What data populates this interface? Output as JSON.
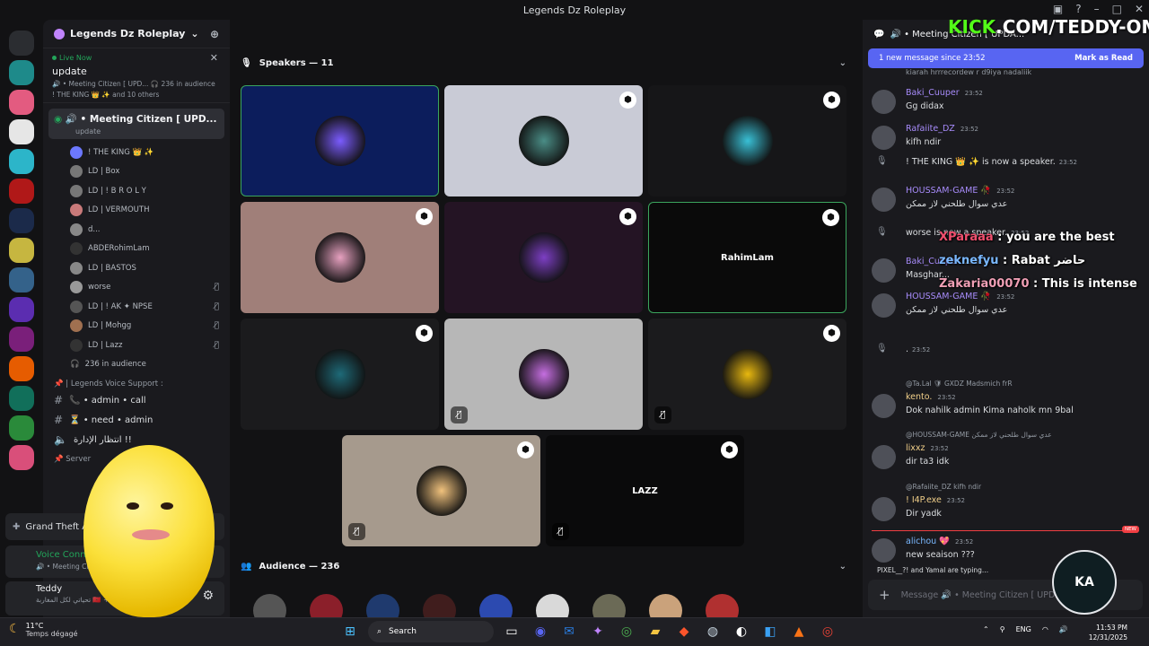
{
  "window": {
    "title": "Legends Dz Roleplay"
  },
  "server": {
    "name": "Legends Dz Roleplay",
    "live": {
      "badge": "Live Now",
      "title": "update",
      "details": "🔊 • Meeting Citizen [ UPD... 🎧 236 in audience",
      "people": "! THE KING 👑 ✨ and 10 others"
    },
    "voice_channel": {
      "name": "🔊 • Meeting Citizen [ UPD...",
      "status": "update"
    },
    "members": [
      {
        "name": "! THE KING 👑 ✨",
        "muted": false,
        "color": "#6c78ff"
      },
      {
        "name": "LD | Box",
        "muted": false,
        "color": "#777"
      },
      {
        "name": "LD | ! B R O L Y",
        "muted": false,
        "color": "#777"
      },
      {
        "name": "LD | VERMOUTH",
        "muted": false,
        "color": "#c97a7a"
      },
      {
        "name": "d...",
        "muted": false,
        "color": "#888"
      },
      {
        "name": "ABDERohimLam",
        "muted": false,
        "color": "#333"
      },
      {
        "name": "LD | BASTOS",
        "muted": false,
        "color": "#888"
      },
      {
        "name": "worse",
        "muted": true,
        "color": "#999"
      },
      {
        "name": "LD | ! AK ✦ NPSE",
        "muted": true,
        "color": "#555"
      },
      {
        "name": "LD | Mohgg",
        "muted": true,
        "color": "#a07050"
      },
      {
        "name": "LD | Lazz",
        "muted": true,
        "color": "#333"
      }
    ],
    "audience_count": "236 in audience",
    "category": "📌 | Legends Voice Support :",
    "text_channels": [
      {
        "name": "📞 • admin • call"
      },
      {
        "name": "⏳ • need • admin"
      },
      {
        "name": "انتظار الإدارة !!"
      }
    ],
    "category2": "📌 Server",
    "game": "Grand Theft Auto V",
    "voice_connected": {
      "status": "Voice Connected",
      "channel": "🔊 • Meeting Citi..."
    },
    "user": {
      "name": "Teddy",
      "status": "تحياتي لكل المغاربة 🇲🇦 +1"
    }
  },
  "stage": {
    "speakers_header": "Speakers — 11",
    "audience_header": "Audience — 236",
    "tiles": [
      {
        "bg": "#0c1d5c",
        "ring": "#7b5cff",
        "label": "",
        "pin": false,
        "muted": false
      },
      {
        "bg": "#c9cbd6",
        "ring": "#4a8d86",
        "label": "",
        "pin": true,
        "muted": false
      },
      {
        "bg": "#161618",
        "ring": "#39c0d6",
        "label": "",
        "pin": true,
        "muted": false
      },
      {
        "bg": "#a07f79",
        "ring": "#e7a1c0",
        "label": "",
        "pin": true,
        "muted": false
      },
      {
        "bg": "#241424",
        "ring": "#7d3fc4",
        "label": "",
        "pin": true,
        "muted": false
      },
      {
        "bg": "#0a0a0a",
        "ring": "#222",
        "label": "RahimLam",
        "pin": true,
        "muted": false
      },
      {
        "bg": "#1b1b1d",
        "ring": "#1e6a78",
        "label": "",
        "pin": true,
        "muted": false
      },
      {
        "bg": "#b7b7b7",
        "ring": "#c56ee0",
        "label": "",
        "pin": false,
        "muted": true
      },
      {
        "bg": "#1b1b1d",
        "ring": "#e8b80f",
        "label": "",
        "pin": true,
        "muted": true
      },
      {
        "bg": "#a69a8d",
        "ring": "#f1c27d",
        "label": "",
        "pin": true,
        "muted": true
      },
      {
        "bg": "#0a0a0b",
        "ring": "#222",
        "label": "LAZZ",
        "pin": true,
        "muted": true
      }
    ],
    "audience_colors": [
      "#555",
      "#8b1f2a",
      "#1f3a6e",
      "#401d1d",
      "#2c4ab0",
      "#d9d9d9",
      "#6b6a56",
      "#caa27b",
      "#b03030"
    ]
  },
  "chat": {
    "header": "🔊 • Meeting Citizen [ UPDA...",
    "new_messages": "1 new message since 23:52",
    "mark_as_read": "Mark as Read",
    "cut_text": "kiarah hrrrecordew r d9iya nadaliik",
    "messages": [
      {
        "name": "Baki_Cuuper",
        "color": "#a78bfa",
        "time": "23:52",
        "text": "Gg didax",
        "reply": ""
      },
      {
        "name": "Rafaiite_DZ",
        "color": "#a78bfa",
        "time": "23:52",
        "text": "kifh ndir",
        "reply": ""
      },
      {
        "name": "HOUSSAM-GAME 🥀",
        "color": "#a78bfa",
        "time": "23:52",
        "text": "عدي سوال طلحني لاز ممكن",
        "reply": ""
      },
      {
        "name": "Baki_Cuuper",
        "color": "#a78bfa",
        "time": "23:52",
        "text": "Masghar...",
        "reply": ""
      },
      {
        "name": "HOUSSAM-GAME 🥀",
        "color": "#a78bfa",
        "time": "23:52",
        "text": "عدي سوال طلحني لاز ممكن",
        "reply": ""
      },
      {
        "name": "kento.",
        "color": "#f2d08a",
        "time": "23:52",
        "text": "Dok nahilk admin Kima naholk mn 9bal",
        "reply": "@Ta.Lal 🛡 GXDZ Madsmich frR"
      },
      {
        "name": "lixxz",
        "color": "#f2d08a",
        "time": "23:52",
        "text": "dir ta3 idk",
        "reply": "@HOUSSAM-GAME عدي سوال طلحني لاز ممكن"
      },
      {
        "name": "! I4P.exe",
        "color": "#f2d08a",
        "time": "23:52",
        "text": "Dir yadk",
        "reply": "@Rafaiite_DZ kifh ndir"
      },
      {
        "name": "alichou 💖",
        "color": "#7ab8ff",
        "time": "23:52",
        "text": "new seaison ???",
        "reply": ""
      }
    ],
    "system": [
      {
        "text": "! THE KING 👑 ✨ is now a speaker.",
        "time": "23:52"
      },
      {
        "text": "worse is now a speaker.",
        "time": "23:52"
      },
      {
        "text": ".",
        "time": "23:52"
      }
    ],
    "new_tag": "NEW",
    "typing": "PIXEL__?! and Yamal are typing...",
    "input_placeholder": "Message 🔊 • Meeting Citizen [ UPD..."
  },
  "stream_overlay": {
    "kick_prefix": "KICK",
    "kick_suffix": ".COM/TEDDY-OMG",
    "chat_lines": [
      {
        "user": "XParaaa",
        "color": "#f04f6e",
        "text": ": you are the best"
      },
      {
        "user": "zeknefyu",
        "color": "#7ab8ff",
        "text": ": Rabat حاضر"
      },
      {
        "user": "Zakaria00070",
        "color": "#f09fb5",
        "text": ": This is intense"
      }
    ],
    "emblem": "KA"
  },
  "taskbar": {
    "temp": "11°C",
    "weather": "Temps dégagé",
    "search": "Search",
    "lang": "ENG",
    "time": "11:53 PM",
    "date": "12/31/2025"
  }
}
